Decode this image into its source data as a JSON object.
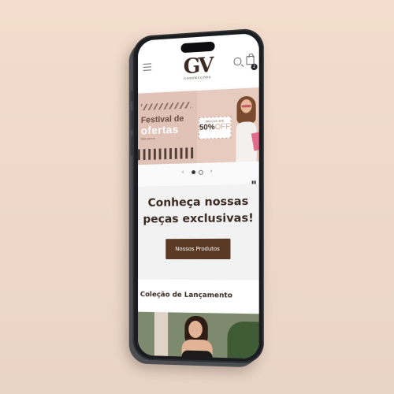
{
  "header": {
    "logo_mark": "GV",
    "logo_subtitle": "CONFECÇÕES",
    "cart_count": "2",
    "icons": [
      "menu-icon",
      "search-icon",
      "shopping-bag-icon"
    ]
  },
  "banner": {
    "title_line1": "Festival de",
    "title_line2": "ofertas",
    "small_text": "Não perca!",
    "promo_top": "PREÇOS ATÉ",
    "promo_value": "50%",
    "promo_suffix": "OFF"
  },
  "carousel": {
    "prev": "‹",
    "next": "›",
    "active_slide": 1,
    "slide_count": 2
  },
  "hero": {
    "title": "Conheça nossas peças exclusivas!",
    "button_label": "Nossos Produtos"
  },
  "section": {
    "title": "Coleção de Lançamento"
  },
  "colors": {
    "brand_brown": "#5a3a24",
    "banner_pink": "#e7cbbf",
    "background": "#f3dccb"
  }
}
